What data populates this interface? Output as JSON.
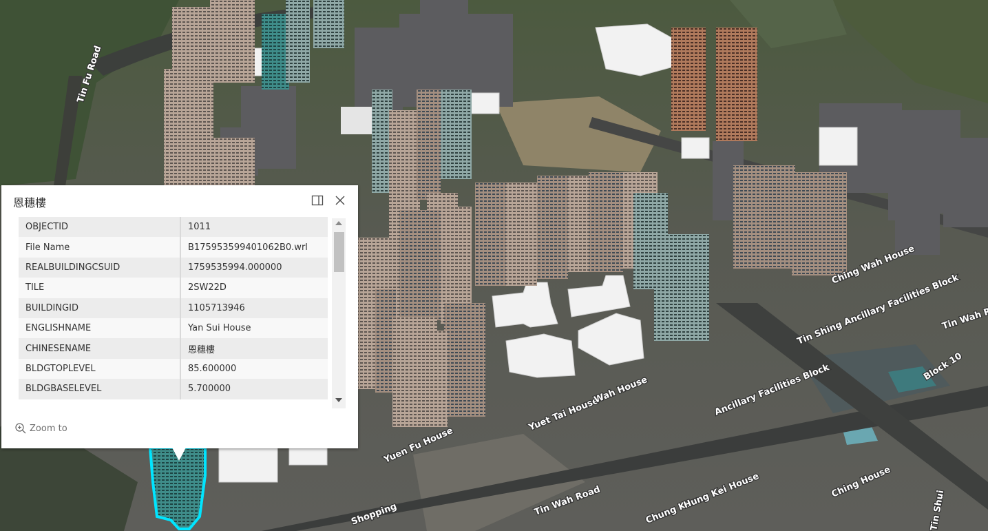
{
  "popup": {
    "title": "恩穗樓",
    "attributes": [
      {
        "key": "OBJECTID",
        "value": "1011"
      },
      {
        "key": "File Name",
        "value": "B175953599401062B0.wrl"
      },
      {
        "key": "REALBUILDINGCSUID",
        "value": "1759535994.000000"
      },
      {
        "key": "TILE",
        "value": "2SW22D"
      },
      {
        "key": "BUILDINGID",
        "value": "1105713946"
      },
      {
        "key": "ENGLISHNAME",
        "value": "Yan Sui House"
      },
      {
        "key": "CHINESENAME",
        "value": "恩穗樓"
      },
      {
        "key": "BLDGTOPLEVEL",
        "value": "85.600000"
      },
      {
        "key": "BLDGBASELEVEL",
        "value": "5.700000"
      }
    ],
    "zoom_label": "Zoom to",
    "icons": {
      "dock": "dock-icon",
      "close": "close-icon",
      "zoom": "zoom-in-icon"
    }
  },
  "map": {
    "labels": {
      "tin_wah_road": "Tin Wah Road",
      "tin_wah_road_right": "Tin Wah R",
      "yuen_fu_house": "Yuen Fu House",
      "yuet_tai_house": "Yuet Tai House",
      "wah_house": "Wah House",
      "chung_kam_house": "Chung Kam",
      "hung_kei_house": "Hung Kei House",
      "ching_house": "Ching House",
      "ancillary_facilities_block": "Ancillary Facilities Block",
      "tin_shing_ancillary": "Tin Shing Ancillary Facilities Block",
      "ching_wah_house": "Ching Wah House",
      "shopping": "Shopping",
      "block_10": "Block 10",
      "tin_fu_road": "Tin Fu Road",
      "tin_shui_road": "Tin Shui"
    },
    "colors": {
      "selection_outline": "#00e5ff",
      "white_massing": "#f2f2f2",
      "grey_massing": "#5c5c5f"
    }
  }
}
